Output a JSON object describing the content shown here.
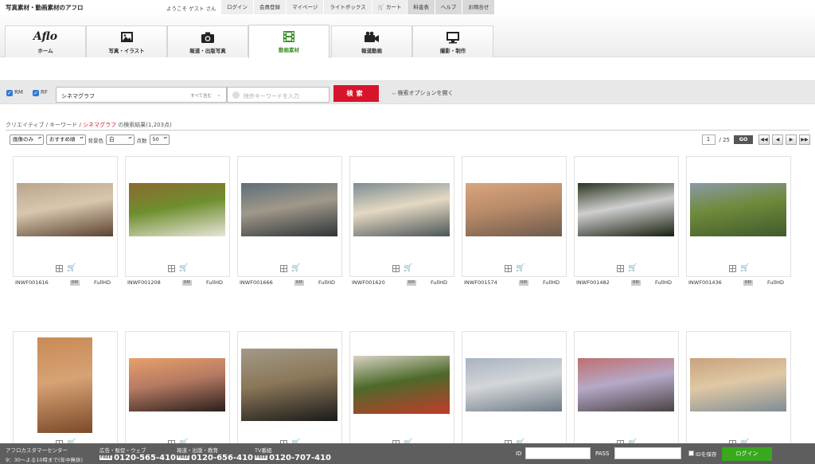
{
  "header": {
    "site_title": "写真素材・動画素材のアフロ",
    "welcome": "ようこそ ゲスト さん",
    "nav": [
      "ログイン",
      "会員登録",
      "マイページ",
      "ライトボックス",
      "カート",
      "料金表",
      "ヘルプ",
      "お問合せ"
    ]
  },
  "tabs": [
    {
      "label": "ホーム",
      "icon": "aflo-logo-icon",
      "logo_text": "Aflo"
    },
    {
      "label": "写真・イラスト",
      "icon": "image-icon"
    },
    {
      "label": "報道・出版写真",
      "icon": "camera-icon"
    },
    {
      "label": "動画素材",
      "icon": "film-icon",
      "active": true
    },
    {
      "label": "報道動画",
      "icon": "video-camera-icon"
    },
    {
      "label": "撮影・制作",
      "icon": "monitor-icon"
    }
  ],
  "search": {
    "rm_label": "RM",
    "rf_label": "RF",
    "keyword": "シネマグラフ",
    "match_mode": "すべて含む",
    "exclude_placeholder": "除外キーワードを入力",
    "button": "検索",
    "options_label": "検索オプションを開く"
  },
  "breadcrumb": {
    "part1": "クリエイティブ",
    "sep": " / ",
    "part2": "キーワード",
    "current": "シネマグラフ",
    "result": " の検索結果(1,203点)"
  },
  "filters": {
    "type": "画像のみ",
    "sort": "おすすめ順",
    "bg_label": "背景色",
    "bg": "白",
    "count_label": "点数",
    "count": "50"
  },
  "pager": {
    "page": "1",
    "total": "/ 25",
    "go": "GO"
  },
  "results": [
    {
      "id": "INWF001616",
      "license": "RM",
      "quality": "FullHD",
      "colors": [
        "#b9a58d",
        "#5b4232",
        "#d8c7ad"
      ]
    },
    {
      "id": "INWF001208",
      "license": "RM",
      "quality": "FullHD",
      "colors": [
        "#8b6a2f",
        "#e9e4da",
        "#6e8f2e"
      ]
    },
    {
      "id": "INWF001666",
      "license": "RM",
      "quality": "FullHD",
      "colors": [
        "#5c6f7a",
        "#2e3438",
        "#a0988a"
      ]
    },
    {
      "id": "INWF001620",
      "license": "RM",
      "quality": "FullHD",
      "colors": [
        "#7d8c93",
        "#4b5559",
        "#e4d9c2"
      ]
    },
    {
      "id": "INWF001574",
      "license": "RM",
      "quality": "FullHD",
      "colors": [
        "#d9a57d",
        "#6e5a4c",
        "#b98b69"
      ]
    },
    {
      "id": "INWF001482",
      "license": "RM",
      "quality": "FullHD",
      "colors": [
        "#29361f",
        "#16200f",
        "#cfcfcf"
      ]
    },
    {
      "id": "INWF001436",
      "license": "RM",
      "quality": "FullHD",
      "colors": [
        "#8b99a9",
        "#3f5a2c",
        "#6f8a3a"
      ]
    },
    {
      "colors": [
        "#c98a56",
        "#7a4a28",
        "#d7a274"
      ]
    },
    {
      "colors": [
        "#e8a06a",
        "#2b1e1c",
        "#b67a63"
      ]
    },
    {
      "colors": [
        "#a29a88",
        "#1a1a1a",
        "#8b7759"
      ]
    },
    {
      "colors": [
        "#d8d2c4",
        "#c23b2a",
        "#4d6a2a"
      ]
    },
    {
      "colors": [
        "#a8b3c0",
        "#6f7a86",
        "#d3d6d9"
      ]
    },
    {
      "colors": [
        "#bf6f6f",
        "#4a4244",
        "#b5a9c8"
      ]
    },
    {
      "colors": [
        "#c7a27d",
        "#7f8d96",
        "#e0c8a4"
      ]
    }
  ],
  "footer": {
    "center_title": "アフロカスタマーセンター",
    "center_hours": "9：30〜よる10時まで(年中無休)",
    "dept1": "広告・販促・ウェブ",
    "tel1": "0120-565-410",
    "dept2": "報道・出版・教育",
    "tel2": "0120-656-410",
    "dept3": "TV番組",
    "tel3": "0120-707-410",
    "tel_badge": "FREE",
    "id_label": "ID",
    "pass_label": "PASS",
    "save_label": "IDを保存",
    "login_button": "ログイン"
  },
  "colors": {
    "accent_red": "#d8142c",
    "active_green": "#3a8f26",
    "login_green": "#39a81d",
    "footer_bg": "#5e5e5e"
  }
}
